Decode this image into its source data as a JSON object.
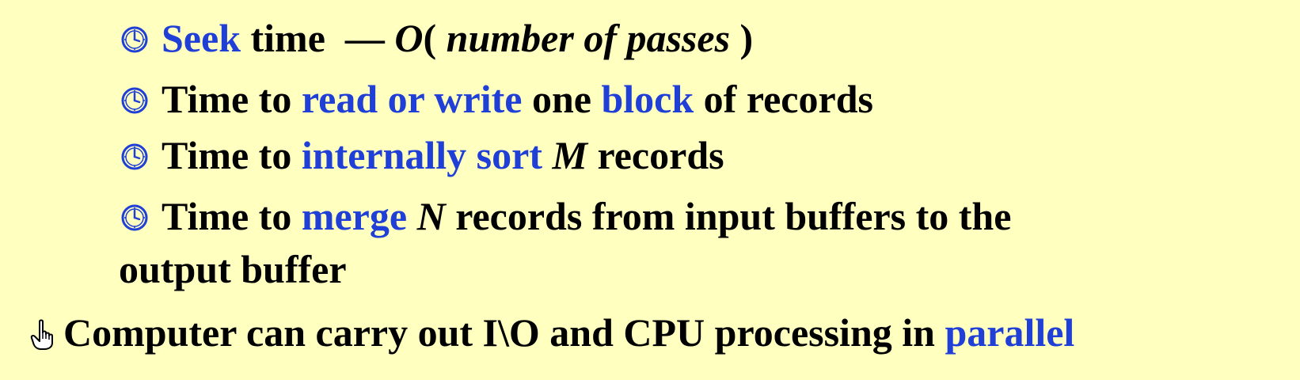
{
  "bullets": [
    {
      "icon": "clock-icon",
      "parts": [
        {
          "text": "Seek",
          "style": "blue"
        },
        {
          "text": " time  — ",
          "style": "plain"
        },
        {
          "text": "O",
          "style": "ital"
        },
        {
          "text": "( ",
          "style": "plain"
        },
        {
          "text": "number of passes",
          "style": "ital"
        },
        {
          "text": " )",
          "style": "plain"
        }
      ]
    },
    {
      "icon": "clock-icon",
      "parts": [
        {
          "text": "Time to ",
          "style": "plain"
        },
        {
          "text": "read or write",
          "style": "blue"
        },
        {
          "text": " one ",
          "style": "plain"
        },
        {
          "text": "block",
          "style": "blue"
        },
        {
          "text": " of records",
          "style": "plain"
        }
      ]
    },
    {
      "icon": "clock-icon",
      "parts": [
        {
          "text": "Time to ",
          "style": "plain"
        },
        {
          "text": "internally sort",
          "style": "blue"
        },
        {
          "text": " ",
          "style": "plain"
        },
        {
          "text": "M",
          "style": "ital"
        },
        {
          "text": " records",
          "style": "plain"
        }
      ]
    },
    {
      "icon": "clock-icon",
      "parts": [
        {
          "text": "Time to ",
          "style": "plain"
        },
        {
          "text": "merge",
          "style": "blue"
        },
        {
          "text": " ",
          "style": "plain"
        },
        {
          "text": "N",
          "style": "ital"
        },
        {
          "text": " records from input buffers to the",
          "style": "plain"
        }
      ],
      "continuation": "output buffer"
    }
  ],
  "main_point": {
    "icon": "pointing-hand-icon",
    "text": "Computer can carry out I\\O and CPU processing in ",
    "highlight": "parallel"
  },
  "colors": {
    "background": "#ffffc0",
    "text": "#000000",
    "highlight": "#1f3fd6"
  }
}
